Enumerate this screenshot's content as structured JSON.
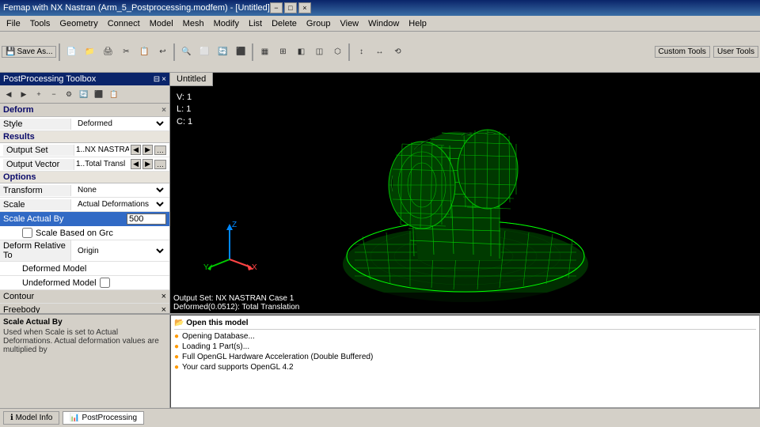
{
  "titlebar": {
    "text": "Femap with NX Nastran (Arm_5_Postprocessing.modfem) - [Untitled]",
    "min": "−",
    "max": "□",
    "close": "×"
  },
  "menu": {
    "items": [
      "File",
      "Tools",
      "Geometry",
      "Connect",
      "Model",
      "Mesh",
      "Modify",
      "List",
      "Delete",
      "Group",
      "View",
      "Window",
      "Help"
    ]
  },
  "viewport": {
    "tab": "Untitled",
    "v": "V: 1",
    "l": "L: 1",
    "c": "C: 1",
    "outputSet": "Output Set: NX NASTRAN Case 1",
    "deformed": "Deformed(0.0512): Total Translation"
  },
  "panel": {
    "title": "PostProcessing Toolbox",
    "sections": {
      "deform": "Deform",
      "results": "Results",
      "options": "Options"
    },
    "style_label": "Style",
    "style_value": "Deformed",
    "output_set_label": "Output Set",
    "output_set_value": "1..NX NASTRA",
    "output_vector_label": "Output Vector",
    "output_vector_value": "1..Total Transl",
    "transform_label": "Transform",
    "transform_value": "None",
    "scale_label": "Scale",
    "scale_value": "Actual Deformations",
    "scale_actual_label": "Scale Actual By",
    "scale_actual_value": "500",
    "scale_based_label": "Scale Based on Grc",
    "deform_relative_label": "Deform Relative To",
    "deform_relative_value": "Origin",
    "deformed_model_label": "Deformed Model",
    "undeformed_model_label": "Undeformed Model",
    "contour": "Contour",
    "freebody": "Freebody"
  },
  "bottom": {
    "tooltip_title": "Scale Actual By",
    "tooltip_text": "Used when Scale is set to Actual Deformations. Actual deformation values are multiplied by",
    "tabs": [
      "Model Info",
      "PostProcessing"
    ],
    "active_tab": "PostProcessing"
  },
  "log": {
    "title": "Open this model",
    "items": [
      {
        "icon": "circle",
        "text": "Opening Database..."
      },
      {
        "icon": "circle",
        "text": "Loading 1 Part(s)..."
      },
      {
        "icon": "circle",
        "text": "Full OpenGL Hardware Acceleration (Double Buffered)"
      },
      {
        "icon": "circle",
        "text": "Your card supports OpenGL 4.2"
      }
    ]
  },
  "customTools": "Custom Tools",
  "userTools": "User Tools"
}
